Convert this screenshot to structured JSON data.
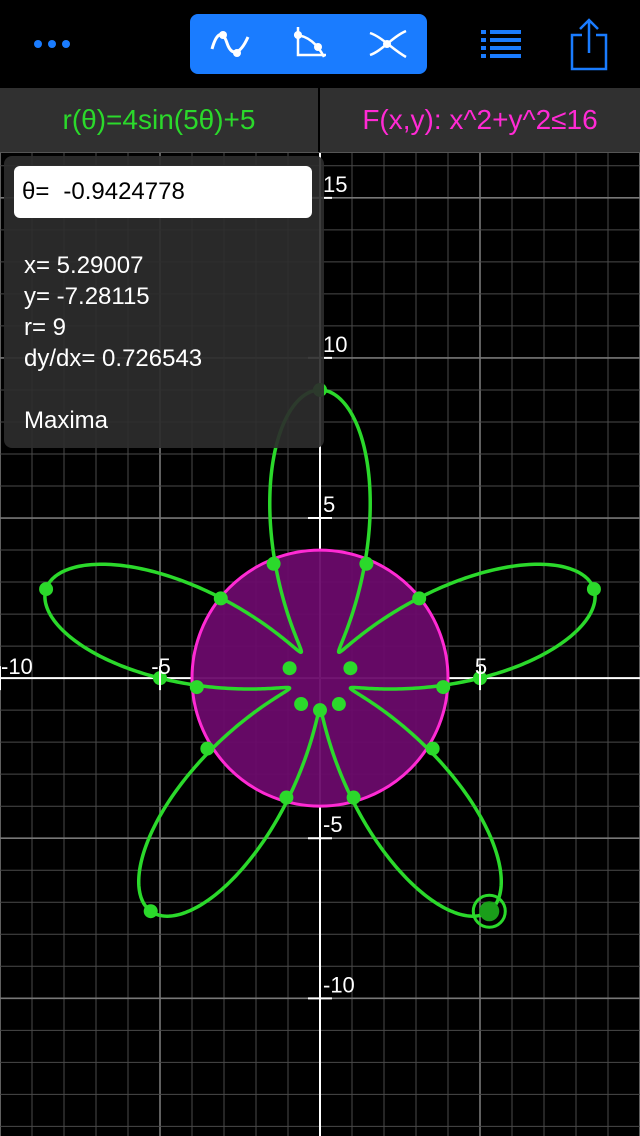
{
  "toolbar": {
    "more_icon": "more-icon",
    "segments": [
      "curve-icon",
      "tangent-icon",
      "intersection-icon"
    ],
    "list_icon": "list-icon",
    "share_icon": "share-icon",
    "accent": "#1a7cff"
  },
  "functions": [
    {
      "label": "r(θ)=4sin(5θ)+5",
      "color": "#2bd92b"
    },
    {
      "label": "F(x,y): x^2+y^2≤16",
      "color": "#ff2ad4"
    }
  ],
  "info": {
    "theta_label": "θ=",
    "theta_value": "-0.9424778",
    "x": "x=  5.29007",
    "y": "y= -7.28115",
    "r": "r=  9",
    "dydx": "dy/dx=  0.726543",
    "point_type": "Maxima"
  },
  "chart_data": {
    "type": "line",
    "xlim": [
      -10,
      10
    ],
    "ylim": [
      -14.3,
      16.4
    ],
    "grid": true,
    "x_ticks": [
      {
        "value": -10,
        "label": "-10"
      },
      {
        "value": -5,
        "label": "-5"
      },
      {
        "value": 5,
        "label": "5"
      }
    ],
    "y_ticks": [
      {
        "value": 15,
        "label": "15"
      },
      {
        "value": 10,
        "label": "10"
      },
      {
        "value": 5,
        "label": "5"
      },
      {
        "value": -5,
        "label": "-5"
      },
      {
        "value": -10,
        "label": "-10"
      }
    ],
    "polar_curve": {
      "expression": "r(θ)=4sin(5θ)+5",
      "amplitude": 4,
      "frequency": 5,
      "offset": 5,
      "color": "#2bd92b"
    },
    "region": {
      "expression": "x^2+y^2≤16",
      "radius": 4,
      "fill": "#6a0a6a",
      "stroke": "#ff2ad4"
    },
    "points": [
      {
        "x": 0,
        "y": 9
      },
      {
        "x": 8.56,
        "y": 2.78
      },
      {
        "x": 5.29,
        "y": -7.28
      },
      {
        "x": -5.29,
        "y": -7.28
      },
      {
        "x": -8.56,
        "y": 2.78
      },
      {
        "x": 0,
        "y": -1
      },
      {
        "x": 0.95,
        "y": 0.31
      },
      {
        "x": 0.59,
        "y": -0.81
      },
      {
        "x": -0.59,
        "y": -0.81
      },
      {
        "x": -0.95,
        "y": 0.31
      },
      {
        "x": 1.45,
        "y": 3.57
      },
      {
        "x": 3.1,
        "y": 2.49
      },
      {
        "x": 3.85,
        "y": -0.28
      },
      {
        "x": 3.52,
        "y": -2.2
      },
      {
        "x": 1.05,
        "y": -3.73
      },
      {
        "x": -1.05,
        "y": -3.73
      },
      {
        "x": -3.52,
        "y": -2.2
      },
      {
        "x": -3.85,
        "y": -0.28
      },
      {
        "x": -3.1,
        "y": 2.49
      },
      {
        "x": -1.45,
        "y": 3.57
      },
      {
        "x": 5,
        "y": 0
      },
      {
        "x": -5,
        "y": 0
      }
    ],
    "selected_point": {
      "x": 5.29,
      "y": -7.28
    }
  }
}
